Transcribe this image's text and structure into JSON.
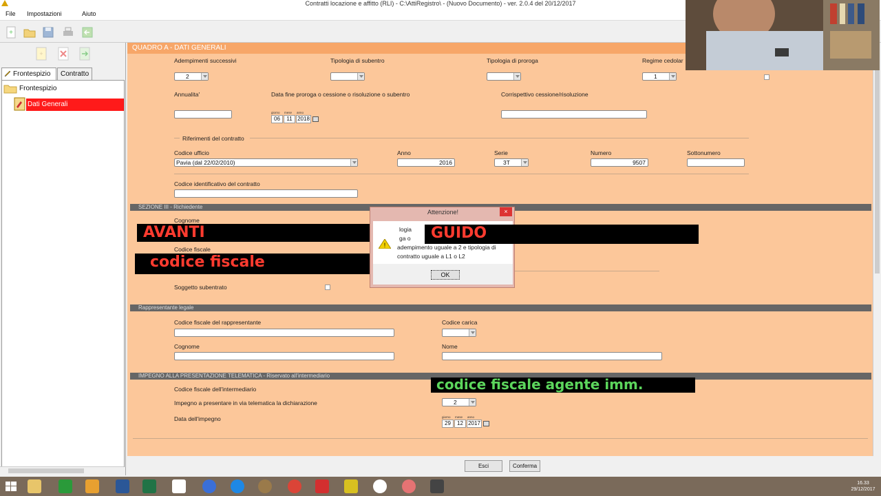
{
  "window": {
    "title": "Contratti locazione e affitto (RLI) - C:\\AttiRegistro\\ - (Nuovo Documento)  -  ver. 2.0.4 del 20/12/2017"
  },
  "menu": {
    "file": "File",
    "impostazioni": "Impostazioni",
    "aiuto": "Aiuto"
  },
  "left": {
    "tabs": {
      "frontespizio": "Frontespizio",
      "contratto": "Contratto"
    },
    "tree": {
      "root": "Frontespizio",
      "child": "Dati Generali"
    }
  },
  "form": {
    "title": "QUADRO A - DATI GENERALI",
    "adempimenti_label": "Adempimenti successivi",
    "adempimenti_value": "2",
    "subentro_label": "Tipologia di subentro",
    "proroga_label": "Tipologia di proroga",
    "cedolare_label": "Regime cedolar",
    "cedolare_value": "1",
    "annualita_label": "Annualita'",
    "data_fine_label": "Data fine proroga o cessione o risoluzione o subentro",
    "date_small": {
      "giorno": "giorno",
      "mese": "mese",
      "anno": "anno"
    },
    "data_fine": {
      "day": "06",
      "month": "11",
      "year": "2018"
    },
    "corrispettivo_label": "Corrispettivo cessione/risoluzione",
    "riferimenti_label": "Riferimenti del contratto",
    "ufficio_label": "Codice ufficio",
    "ufficio_value": "Pavia (dal 22/02/2010)",
    "anno_label": "Anno",
    "anno_value": "2016",
    "serie_label": "Serie",
    "serie_value": "3T",
    "numero_label": "Numero",
    "numero_value": "9507",
    "sottonumero_label": "Sottonumero",
    "identificativo_label": "Codice identificativo del contratto"
  },
  "sezione3": {
    "title": "SEZIONE III - Richiedente",
    "cognome_label": "Cognome",
    "cf_label": "Codice fiscale",
    "subentrato_label": "Soggetto subentrato"
  },
  "rappresentante": {
    "title": "Rappresentante legale",
    "cf_label": "Codice fiscale del rappresentante",
    "carica_label": "Codice carica",
    "cognome_label": "Cognome",
    "nome_label": "Nome"
  },
  "impegno": {
    "title": "IMPEGNO ALLA PRESENTAZIONE TELEMATICA - Riservato all'intermediario",
    "cf_label": "Codice fiscale dell'intermediario",
    "impegno_label": "Impegno a presentare in via telematica la dichiarazione",
    "impegno_value": "2",
    "data_label": "Data dell'impegno",
    "data": {
      "day": "29",
      "month": "12",
      "year": "2017"
    }
  },
  "dialog": {
    "title": "Attenzione!",
    "close": "×",
    "line1": "logia",
    "line2": "ga o",
    "line3": "adempimento uguale a 2 e tipologia di",
    "line4": "contratto uguale a  L1 o L2",
    "ok": "OK"
  },
  "overlays": {
    "avanti": "AVANTI",
    "guido": "GUIDO",
    "cf": "codice fiscale",
    "cf_agente": "codice fiscale agente imm."
  },
  "buttons": {
    "esci": "Esci",
    "conferma": "Conferma"
  },
  "taskbar": {
    "time": "16.33",
    "date": "29/12/2017"
  },
  "colors": {
    "form_bg": "#fcc79a",
    "header_bg": "#f7a668",
    "overlay_red": "#ff3b2f",
    "overlay_green": "#5cd65c"
  }
}
